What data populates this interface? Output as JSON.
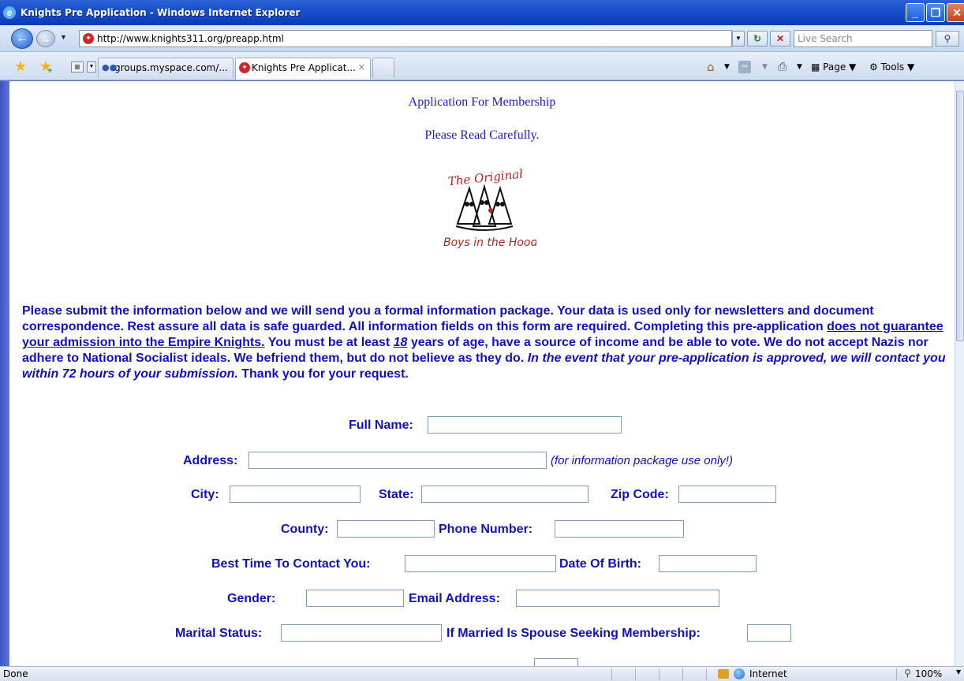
{
  "window": {
    "title": "Knights Pre Application - Windows Internet Explorer",
    "minimize": "_",
    "maximize": "❐",
    "close": "✕"
  },
  "nav": {
    "url": "http://www.knights311.org/preapp.html",
    "search_placeholder": "Live Search"
  },
  "tabs": [
    {
      "label": "groups.myspace.com/...",
      "icon": "myspace-icon"
    },
    {
      "label": "Knights Pre Applicat...",
      "icon": "site-icon",
      "active": true
    },
    {
      "label": "",
      "icon": "new-tab-icon"
    }
  ],
  "commandbar": {
    "page": "Page",
    "tools": "Tools"
  },
  "page": {
    "heading": "Application For Membership",
    "subheading": "Please Read Carefully.",
    "logo_text_top": "The Original",
    "logo_text_bottom": "Boys in the Hood",
    "intro_1": "Please submit the information below and we will send you a formal information package. Your data is used only for newsletters and document correspondence. Rest assure all data is safe guarded. All information fields on this form are required. Completing this pre-application ",
    "intro_underline": "does not guarantee your admission into the Empire Knights.",
    "intro_2": " You must be at least ",
    "intro_age": "18",
    "intro_3": " years of age, have a source of income and be able to vote. We do not accept Nazis nor adhere to National Socialist ideals. We befriend them, but do not believe as they do. ",
    "intro_italic": "In the event that your pre-application is approved, we will contact you within 72 hours of your submission.",
    "intro_4": " Thank you for your request."
  },
  "form": {
    "full_name": "Full Name:",
    "address": "Address:",
    "address_note": "(for information package use only!)",
    "city": "City:",
    "state": "State:",
    "zip": "Zip Code:",
    "county": "County:",
    "phone": "Phone Number:",
    "best_time": "Best Time To Contact You:",
    "dob": "Date Of Birth:",
    "gender": "Gender:",
    "email": "Email Address:",
    "marital": "Marital Status:",
    "spouse": "If Married Is Spouse Seeking Membership:"
  },
  "status": {
    "text": "Done",
    "zone": "Internet",
    "zoom": "100%"
  }
}
